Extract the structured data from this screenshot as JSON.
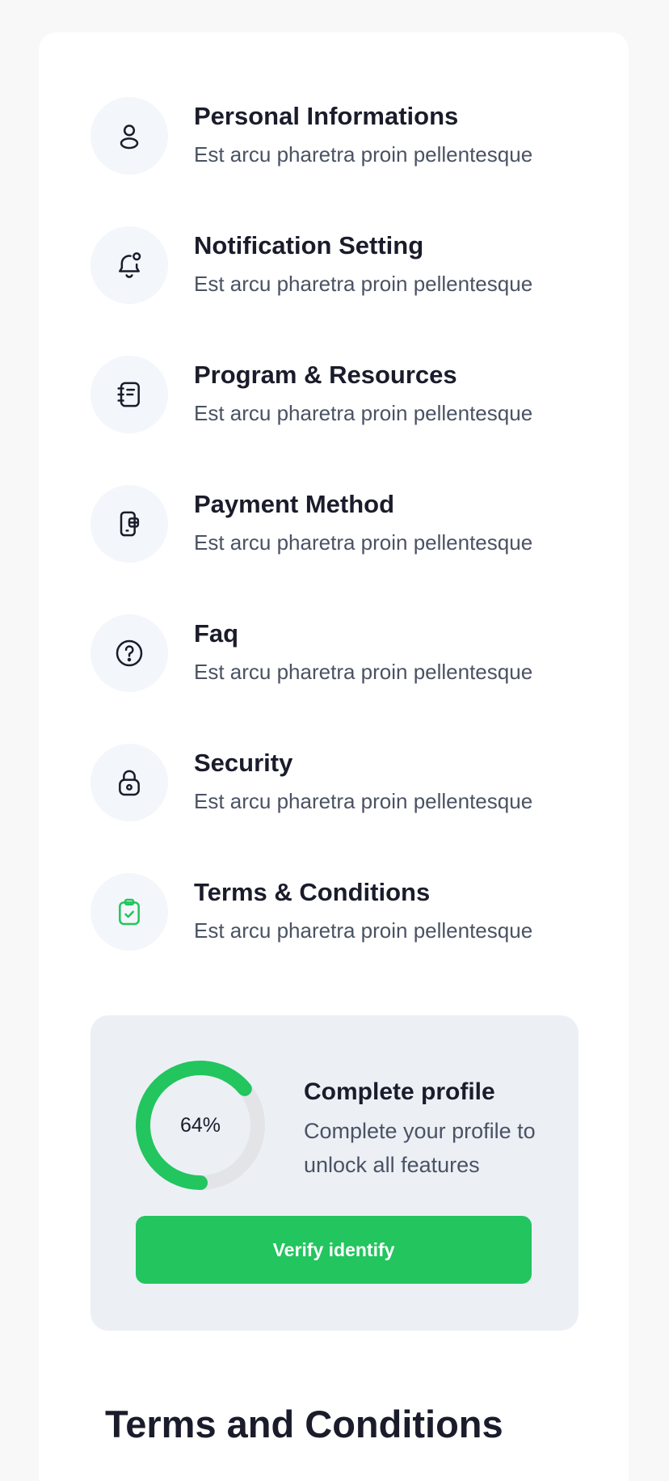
{
  "menu": {
    "items": [
      {
        "title": "Personal Informations",
        "subtitle": "Est arcu pharetra proin pellentesque",
        "icon": "user-icon"
      },
      {
        "title": "Notification Setting",
        "subtitle": "Est arcu pharetra proin pellentesque",
        "icon": "bell-icon"
      },
      {
        "title": "Program & Resources",
        "subtitle": "Est arcu pharetra proin pellentesque",
        "icon": "notebook-icon"
      },
      {
        "title": "Payment Method",
        "subtitle": "Est arcu pharetra proin pellentesque",
        "icon": "wallet-phone-icon"
      },
      {
        "title": "Faq",
        "subtitle": "Est arcu pharetra proin pellentesque",
        "icon": "question-circle-icon"
      },
      {
        "title": "Security",
        "subtitle": "Est arcu pharetra proin pellentesque",
        "icon": "lock-icon"
      },
      {
        "title": "Terms & Conditions",
        "subtitle": "Est arcu pharetra proin pellentesque",
        "icon": "clipboard-check-icon"
      }
    ]
  },
  "profile": {
    "progress_label": "64%",
    "progress_value": 0.64,
    "title": "Complete profile",
    "description": "Complete your profile to unlock all features",
    "verify_label": "Verify identify"
  },
  "section": {
    "heading": "Terms and Conditions"
  },
  "colors": {
    "accent": "#22c55e",
    "text_dark": "#1a1c2b",
    "text_muted": "#4a5263",
    "icon_bg": "#f3f6fa",
    "panel_bg": "#ecf0f5"
  }
}
